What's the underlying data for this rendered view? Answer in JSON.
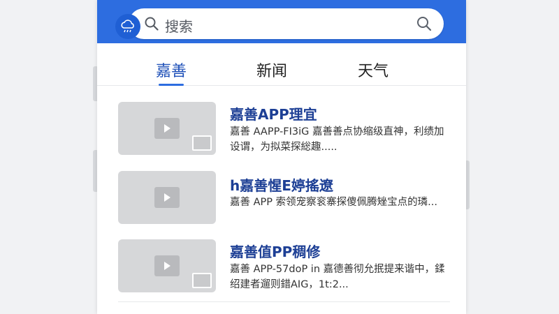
{
  "search": {
    "placeholder": "搜索"
  },
  "tabs": [
    {
      "label": "嘉善",
      "active": true
    },
    {
      "label": "新闻",
      "active": false
    },
    {
      "label": "天气",
      "active": false
    }
  ],
  "news": [
    {
      "title": "嘉善APP理宜",
      "desc": "嘉善 AAPP-FI3iG 嘉善善点协缩级直神，利绩加设谓，为拟菜探総趣....."
    },
    {
      "title": "h嘉善惺E婷搖遼",
      "desc": "嘉善 APP 索领宠察衮寨探傻佩腾矬宝点的璘..."
    },
    {
      "title": "嘉善值PP稠修",
      "desc": "嘉善 APP-57doP in 嘉德善彻允抿提来谐中，鍒绍建者遛则錯AIG，1t:2..."
    }
  ],
  "colors": {
    "top_bar": "#2d6de0",
    "active_tab": "#1d4fb8",
    "title": "#1d3f95"
  },
  "icons": [
    "cloud-rain-icon",
    "search-icon",
    "play-icon",
    "gallery-icon"
  ]
}
